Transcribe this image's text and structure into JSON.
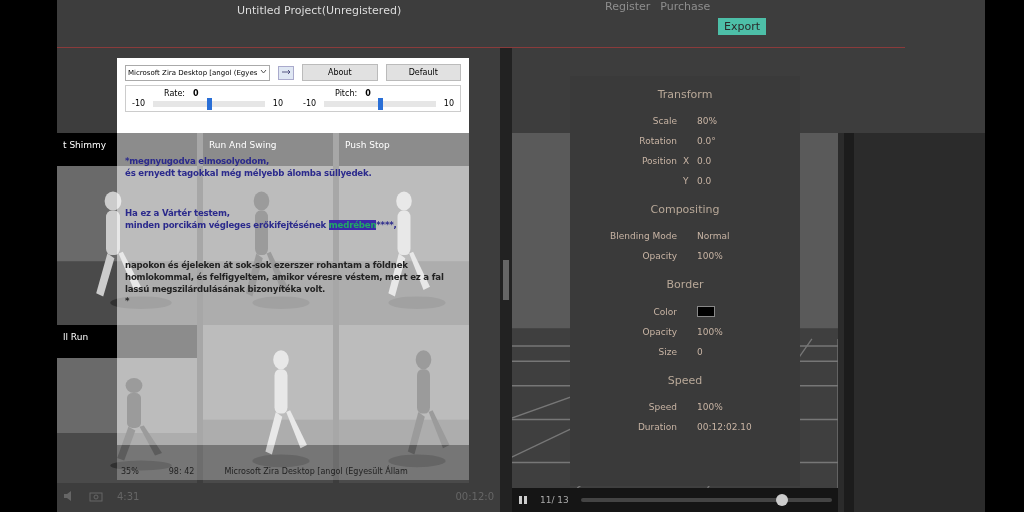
{
  "window": {
    "title": "Untitled Project(Unregistered)"
  },
  "header": {
    "links": [
      "Register",
      "Purchase"
    ],
    "export": "Export"
  },
  "library": {
    "cells": [
      {
        "label": "t Shimmy"
      },
      {
        "label": "Run And Swing"
      },
      {
        "label": "Push Stop"
      },
      {
        "label": "ll Run"
      },
      {
        "kind": "picture"
      },
      {
        "kind": "picture"
      }
    ],
    "time": "4:31",
    "end_time": "00:12:0"
  },
  "properties": [
    {
      "kind": "heading",
      "text": "Transform"
    },
    {
      "kind": "row",
      "label": "Scale",
      "value": "80%"
    },
    {
      "kind": "row",
      "label": "Rotation",
      "value": "0.0°"
    },
    {
      "kind": "row",
      "label": "Position",
      "axis": "X",
      "value": "0.0"
    },
    {
      "kind": "row",
      "axis": "Y",
      "value": "0.0"
    },
    {
      "kind": "heading",
      "text": "Compositing"
    },
    {
      "kind": "row",
      "label": "Blending Mode",
      "value": "Normal"
    },
    {
      "kind": "row",
      "label": "Opacity",
      "value": "100%"
    },
    {
      "kind": "heading",
      "text": "Border"
    },
    {
      "kind": "color",
      "label": "Color",
      "color": "#000000"
    },
    {
      "kind": "row",
      "label": "Opacity",
      "value": "100%"
    },
    {
      "kind": "row",
      "label": "Size",
      "value": "0"
    },
    {
      "kind": "heading",
      "text": "Speed"
    },
    {
      "kind": "row",
      "label": "Speed",
      "value": "100%"
    },
    {
      "kind": "row",
      "label": "Duration",
      "value": "00:12:02.10"
    }
  ],
  "player": {
    "counter": "11/ 13",
    "level": 0.8
  },
  "tts": {
    "voice": "Microsoft Zira Desktop [angol (Egyes",
    "buttons": [
      "About",
      "Default"
    ],
    "sliders": [
      {
        "label": "Rate:",
        "value": "0",
        "min": "-10",
        "max": "10",
        "level": 0.5
      },
      {
        "label": "Pitch:",
        "value": "0",
        "min": "-10",
        "max": "10",
        "level": 0.5
      }
    ],
    "lines": [
      {
        "text": "*megnyugodva elmosolyodom,"
      },
      {
        "text": "és ernyedt tagokkal még mélyebb álomba süllyedek."
      },
      {
        "text": "Ha ez a Vártér testem,",
        "gap": true
      },
      {
        "text": "minden porcikám végleges erőkifejtésének ",
        "selected_word": "medrében",
        "after": "****,"
      },
      {
        "text": "napokon és éjeleken át sok-sok ezerszer rohantam a földnek",
        "gap": true
      },
      {
        "text": "homlokommal, és felfigyeltem, amikor véresre véstem, mert ez a fal"
      },
      {
        "text": "lassú megszilárdulásának bizonyítéka volt."
      },
      {
        "text": "*"
      }
    ],
    "status": [
      "35%",
      "98: 42",
      "Microsoft Zira Desktop [angol (Egyesült Állam"
    ]
  }
}
